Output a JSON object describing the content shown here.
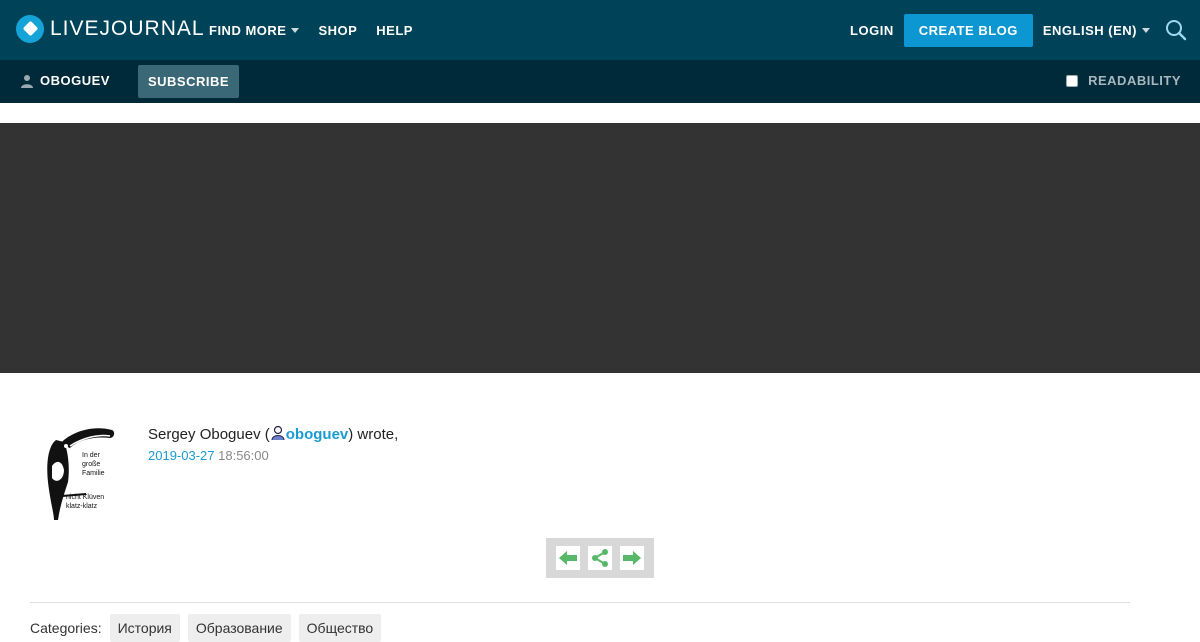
{
  "header": {
    "logo_text": "LIVEJOURNAL",
    "nav": [
      {
        "label": "FIND MORE",
        "dropdown": true
      },
      {
        "label": "SHOP"
      },
      {
        "label": "HELP"
      }
    ],
    "login_label": "LOGIN",
    "create_blog_label": "CREATE BLOG",
    "language_label": "ENGLISH (EN)",
    "accent_color": "#0c96d2"
  },
  "subbar": {
    "username": "OBOGUEV",
    "subscribe_label": "SUBSCRIBE",
    "readability_label": "READABILITY"
  },
  "post": {
    "author_name": "Sergey Oboguev (",
    "author_username": "oboguev",
    "wrote": ") wrote,",
    "date": "2019-03-27",
    "time": "18:56:00",
    "avatar_text": [
      "In der",
      "große",
      "Familie",
      "nicht Klüven",
      "klatz-klatz"
    ]
  },
  "categories": {
    "label": "Categories:",
    "tags": [
      "История",
      "Образование",
      "Общество"
    ]
  }
}
